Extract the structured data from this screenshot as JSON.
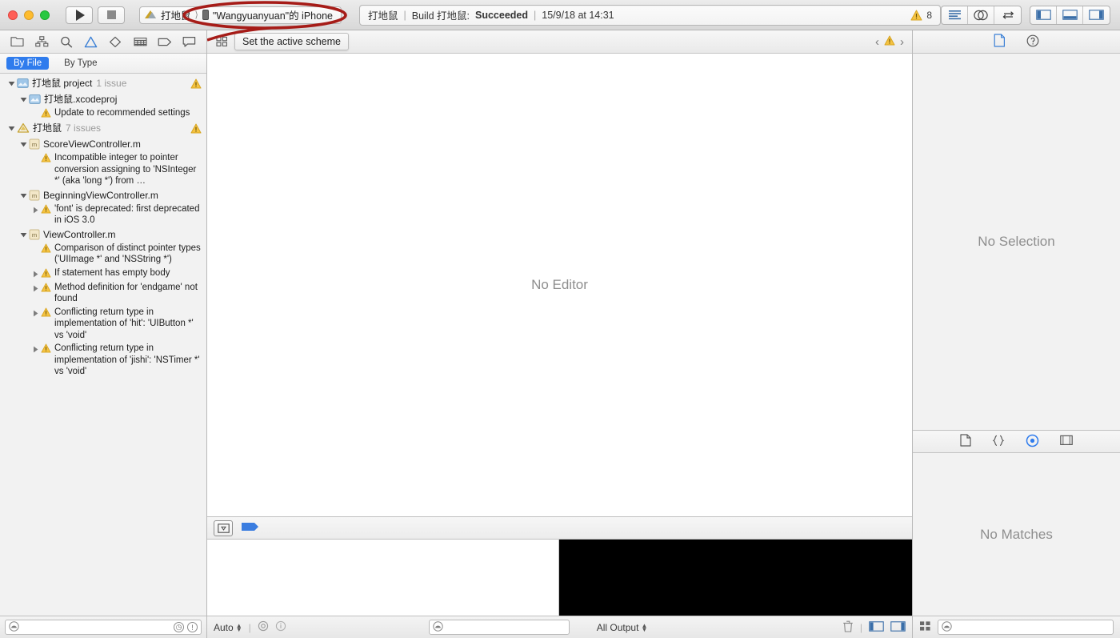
{
  "window": {
    "traffic_lights": [
      "close",
      "minimize",
      "zoom"
    ]
  },
  "toolbar": {
    "run_label": "Run",
    "stop_label": "Stop",
    "scheme": {
      "project": "打地鼠",
      "separator": "⟩",
      "destination": "\"Wangyuanyuan\"的 iPhone"
    },
    "status": {
      "project": "打地鼠",
      "divider": "|",
      "action": "Build 打地鼠:",
      "result": "Succeeded",
      "timestamp": "15/9/18 at 14:31",
      "warning_count": "8"
    },
    "editor_modes": [
      "standard-editor",
      "assistant-editor",
      "version-editor"
    ],
    "view_toggles": [
      "navigator-toggle",
      "debug-toggle",
      "utilities-toggle"
    ]
  },
  "navigator": {
    "tabs": [
      "folder-icon",
      "hierarchy-icon",
      "search-icon",
      "warning-icon",
      "breakpoint-icon",
      "test-icon",
      "tag-icon",
      "report-icon"
    ],
    "active_tab": "warning-icon",
    "filters": [
      {
        "label": "By File",
        "active": true
      },
      {
        "label": "By Type",
        "active": false
      }
    ],
    "tree": [
      {
        "level": 0,
        "twisty": "down",
        "icon": "project-icon",
        "label": "打地鼠 project",
        "sub": "1 issue",
        "warn_right": true
      },
      {
        "level": 1,
        "twisty": "down",
        "icon": "xcodeproj-icon",
        "label": "打地鼠.xcodeproj",
        "sub": "",
        "warn_right": false
      },
      {
        "level": 2,
        "twisty": "none",
        "icon": "warning-icon",
        "message": "Update to recommended settings"
      },
      {
        "level": 0,
        "twisty": "down",
        "icon": "target-icon",
        "label": "打地鼠",
        "sub": "7 issues",
        "warn_right": true
      },
      {
        "level": 1,
        "twisty": "down",
        "icon": "m-file-icon",
        "label": "ScoreViewController.m",
        "sub": "",
        "warn_right": false
      },
      {
        "level": 2,
        "twisty": "none",
        "icon": "warning-icon",
        "message": "Incompatible integer to pointer conversion assigning to 'NSInteger *' (aka 'long *') from …"
      },
      {
        "level": 1,
        "twisty": "down",
        "icon": "m-file-icon",
        "label": "BeginningViewController.m",
        "sub": "",
        "warn_right": false
      },
      {
        "level": 2,
        "twisty": "right",
        "icon": "warning-icon",
        "message": "'font' is deprecated: first deprecated in iOS 3.0"
      },
      {
        "level": 1,
        "twisty": "down",
        "icon": "m-file-icon",
        "label": "ViewController.m",
        "sub": "",
        "warn_right": false
      },
      {
        "level": 2,
        "twisty": "none",
        "icon": "warning-icon",
        "message": "Comparison of distinct pointer types ('UIImage *' and 'NSString *')"
      },
      {
        "level": 2,
        "twisty": "right",
        "icon": "warning-icon",
        "message": "If statement has empty body"
      },
      {
        "level": 2,
        "twisty": "right",
        "icon": "warning-icon",
        "message": "Method definition for 'endgame' not found"
      },
      {
        "level": 2,
        "twisty": "right",
        "icon": "warning-icon",
        "message": "Conflicting return type in implementation of 'hit': 'UIButton *' vs 'void'"
      },
      {
        "level": 2,
        "twisty": "right",
        "icon": "warning-icon",
        "message": "Conflicting return type in implementation of 'jishi': 'NSTimer *' vs 'void'"
      }
    ],
    "bottom": {
      "filter_placeholder": "",
      "icons": [
        "recent-filter-icon",
        "warning-filter-icon"
      ]
    }
  },
  "editor": {
    "jumpbar": {
      "related_items_icon": "related-items-icon",
      "tooltip": "Set the active scheme",
      "back_icon": "back-chevron-icon",
      "issue_icon": "warning-icon",
      "forward_icon": "forward-chevron-icon"
    },
    "placeholder": "No Editor"
  },
  "debug": {
    "toolbar": {
      "hide_icon": "hide-debug-area-icon",
      "breakpoint_icon": "breakpoint-toggle-icon"
    },
    "console_text": "",
    "status": {
      "scope_label": "Auto",
      "eye_icon": "eye-icon",
      "info_icon": "info-icon",
      "variables_filter_placeholder": "",
      "output_label": "All Output",
      "trash_icon": "trash-icon",
      "split_toggles": [
        "variables-view-toggle",
        "console-view-toggle"
      ]
    }
  },
  "utilities": {
    "inspector_tabs": [
      "file-inspector-icon",
      "quick-help-icon"
    ],
    "active_inspector_tab": "file-inspector-icon",
    "inspector_message": "No Selection",
    "library_tabs": [
      "file-template-library-icon",
      "code-snippet-library-icon",
      "object-library-icon",
      "media-library-icon"
    ],
    "active_library_tab": "object-library-icon",
    "library_message": "No Matches",
    "bottom": {
      "grid_icon": "library-grid-icon",
      "filter_placeholder": ""
    }
  },
  "annotations": {
    "ellipse_color": "#a61c18",
    "target": "scheme-selector"
  }
}
